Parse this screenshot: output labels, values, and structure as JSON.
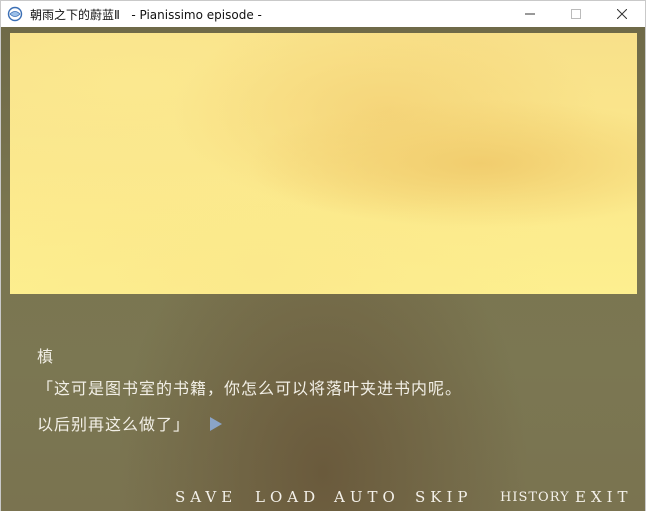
{
  "window": {
    "title": "朝雨之下的蔚蓝Ⅱ   - Pianissimo episode -",
    "controls": [
      "minimize",
      "maximize",
      "close"
    ]
  },
  "dialogue": {
    "speaker": "槙",
    "line1": "「这可是图书室的书籍，你怎么可以将落叶夹进书内呢。",
    "line2": "以后别再这么做了」"
  },
  "menu": {
    "save": "SAVE",
    "load": "LOAD",
    "auto": "AUTO",
    "skip": "SKIP",
    "history": "HISTORY",
    "exit": "EXIT"
  },
  "colors": {
    "scene_yellow": "#fbe88c",
    "dialogue_panel": "#7a7550",
    "text": "#f2efe6",
    "next_arrow": "#8aa4c8"
  }
}
